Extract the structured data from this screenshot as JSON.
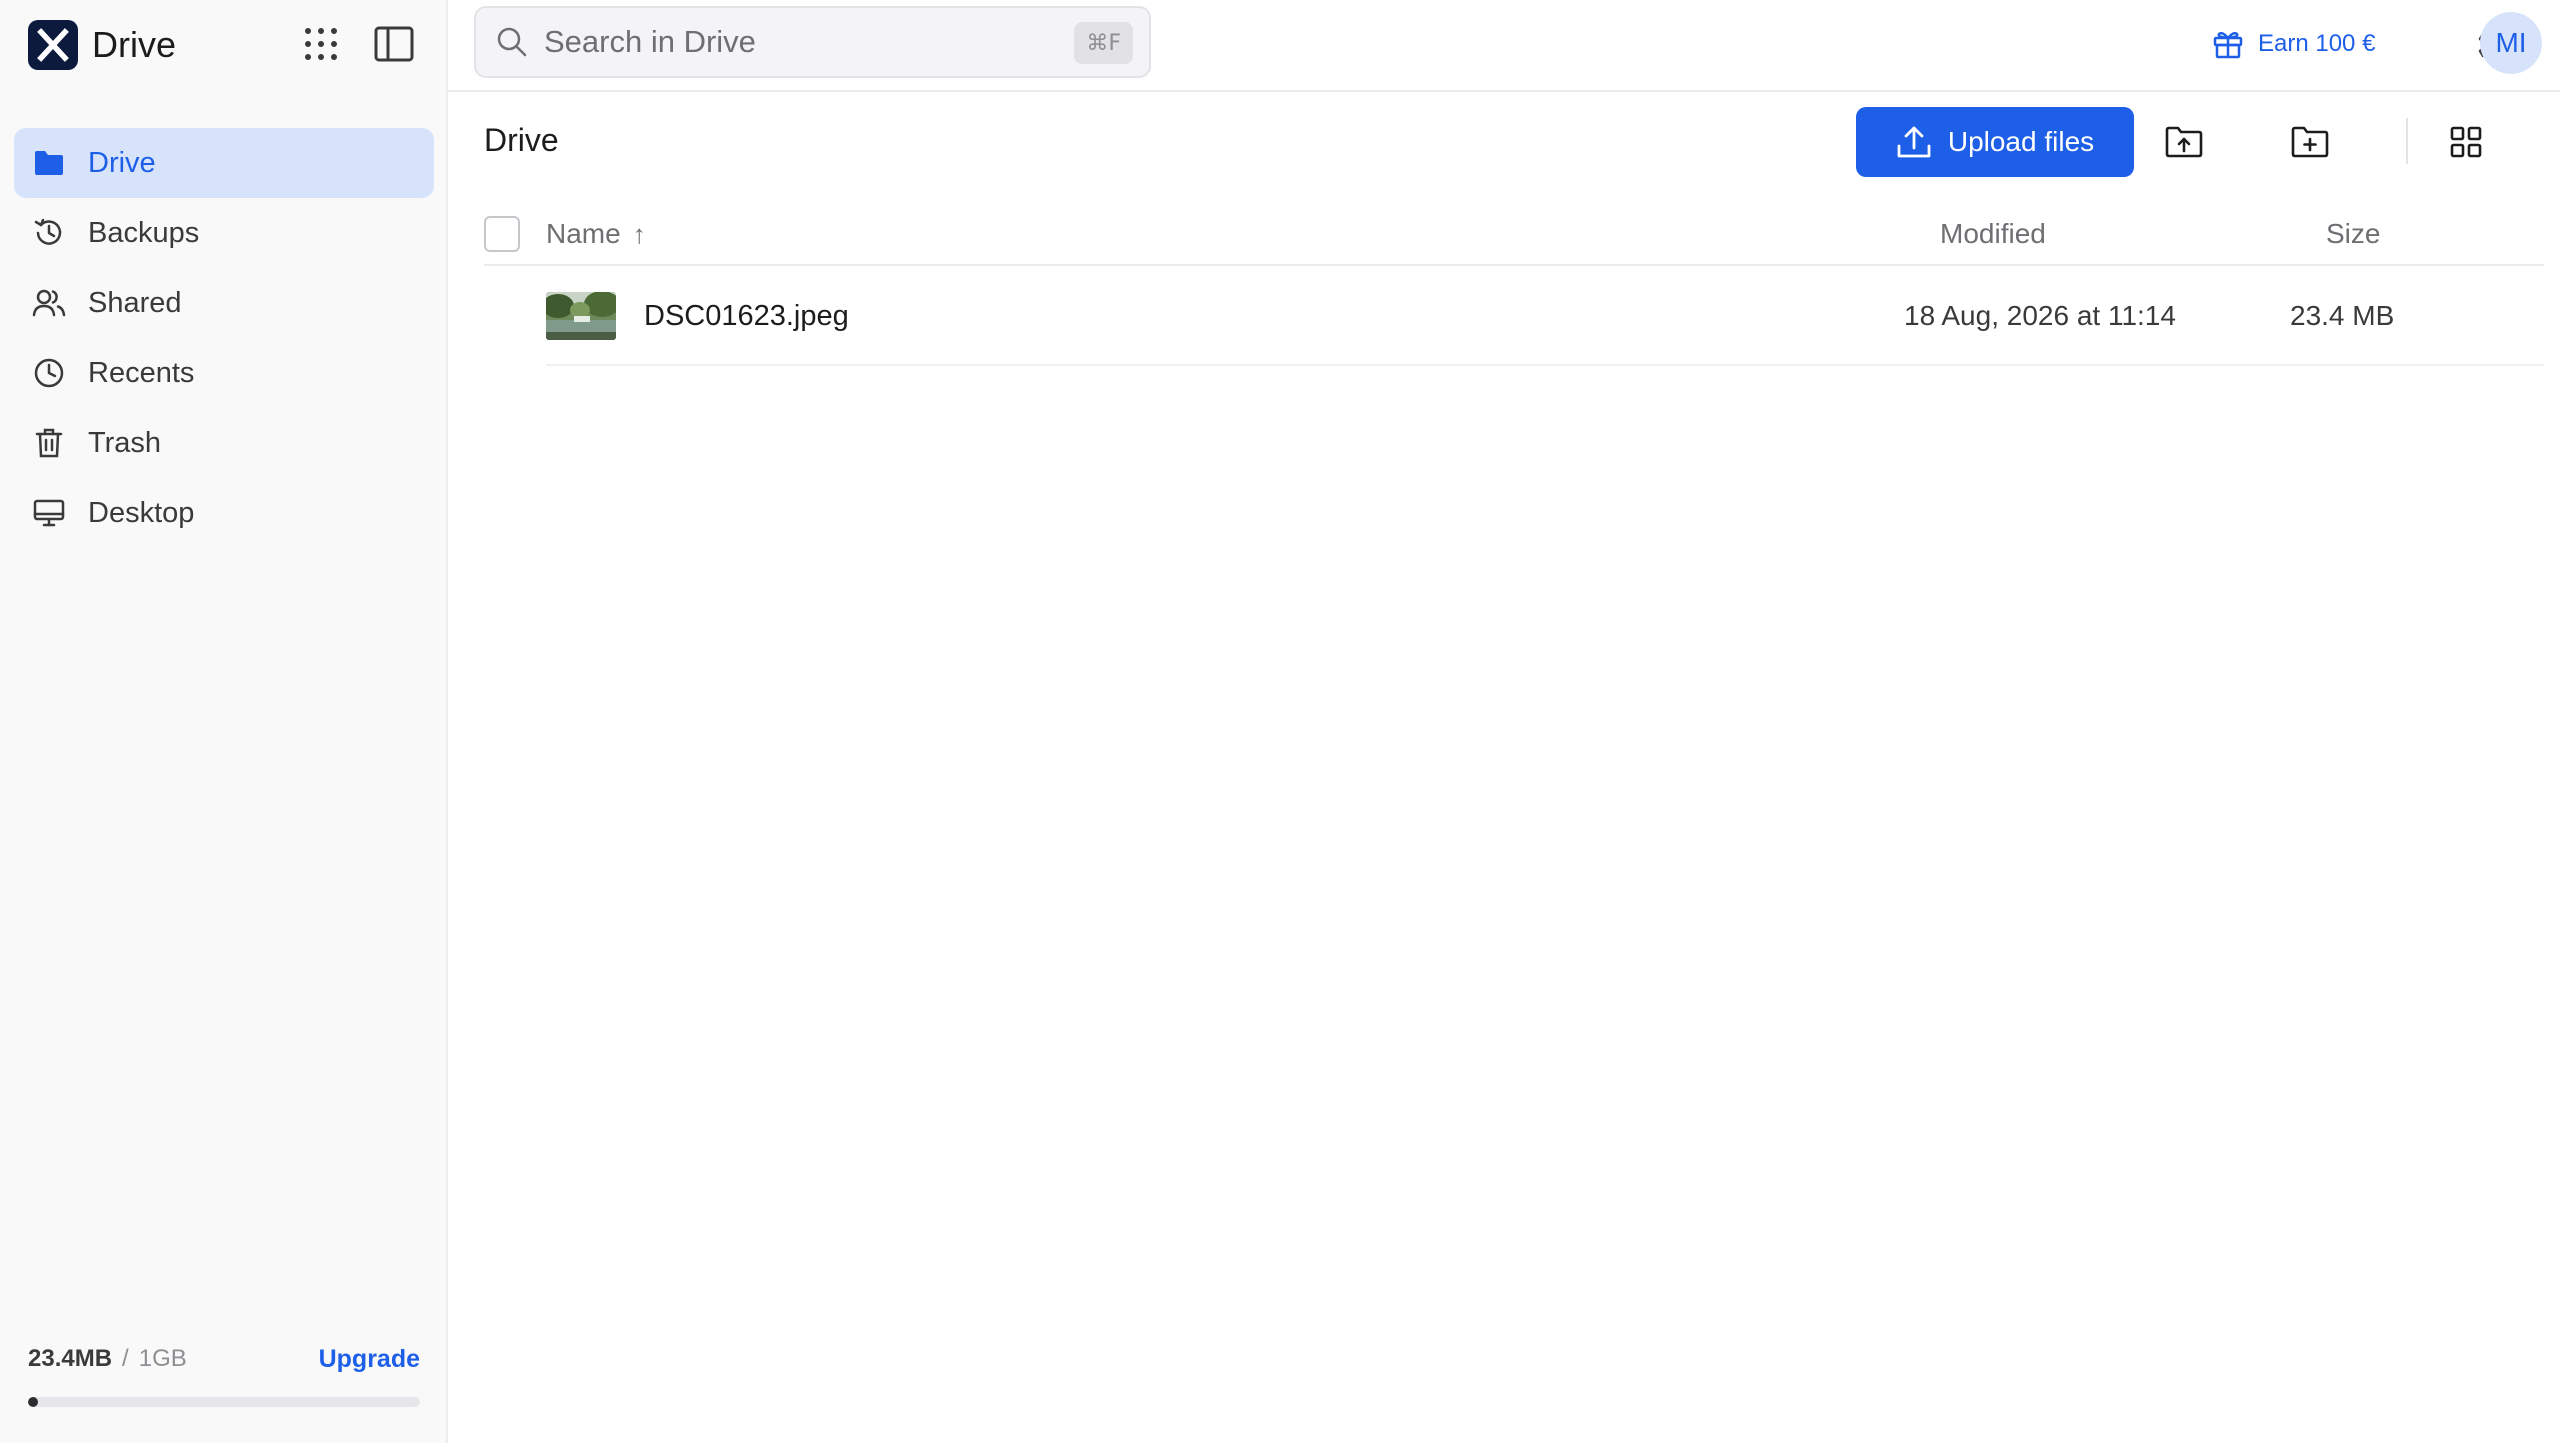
{
  "brand": {
    "name": "Drive",
    "logo_letter": "X",
    "logo_icon": "internxt-logo"
  },
  "sidebar": {
    "items": [
      {
        "label": "Drive",
        "icon": "folder-icon",
        "active": true
      },
      {
        "label": "Backups",
        "icon": "history-icon",
        "active": false
      },
      {
        "label": "Shared",
        "icon": "users-icon",
        "active": false
      },
      {
        "label": "Recents",
        "icon": "clock-icon",
        "active": false
      },
      {
        "label": "Trash",
        "icon": "trash-icon",
        "active": false
      },
      {
        "label": "Desktop",
        "icon": "monitor-icon",
        "active": false
      }
    ],
    "storage": {
      "used": "23.4MB",
      "separator": "/",
      "total": "1GB",
      "upgrade_label": "Upgrade",
      "used_fraction": 0.023
    }
  },
  "search": {
    "placeholder": "Search in Drive",
    "shortcut": "⌘F"
  },
  "header": {
    "earn_label": "Earn 100 €",
    "avatar_initials": "MI"
  },
  "main": {
    "title": "Drive",
    "upload_label": "Upload files",
    "columns": {
      "name": "Name",
      "sort_indicator": "↑",
      "modified": "Modified",
      "size": "Size"
    },
    "files": [
      {
        "name": "DSC01623.jpeg",
        "modified": "18 Aug, 2026 at 11:14",
        "size": "23.4 MB"
      }
    ]
  },
  "colors": {
    "accent": "#1e5fe8",
    "active_bg": "#d6e3fb",
    "sidebar_bg": "#f9f9fa"
  }
}
